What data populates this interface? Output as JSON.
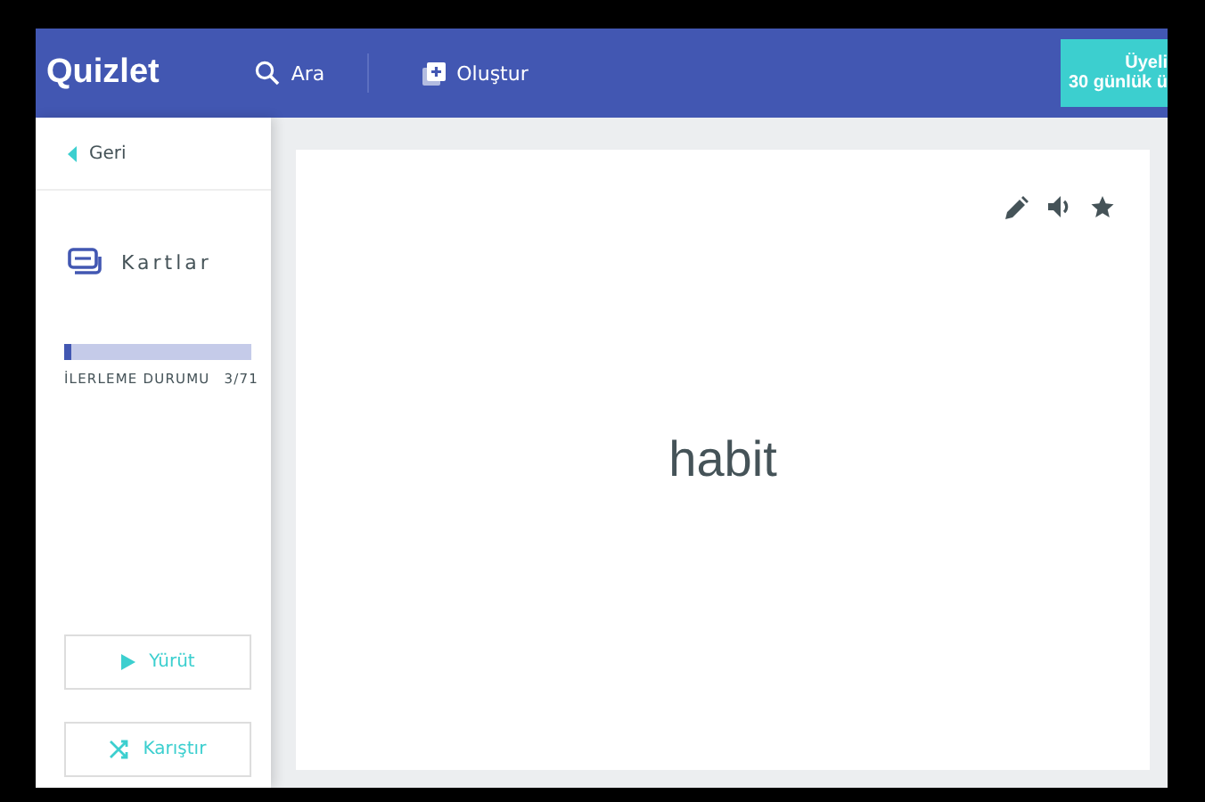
{
  "header": {
    "logo": "Quizlet",
    "search": "Ara",
    "create": "Oluştur",
    "upgrade": [
      "Üyeli",
      "30 günlük ü"
    ]
  },
  "sidebar": {
    "back": "Geri",
    "mode": "Kartlar",
    "progress": {
      "label": "İLERLEME DURUMU",
      "count": "3/71",
      "level": 0.042
    },
    "buttons": [
      {
        "kind": "play",
        "label": "Yürüt"
      },
      {
        "kind": "shuffle",
        "label": "Karıştır"
      }
    ]
  },
  "card": {
    "term": "habit"
  }
}
